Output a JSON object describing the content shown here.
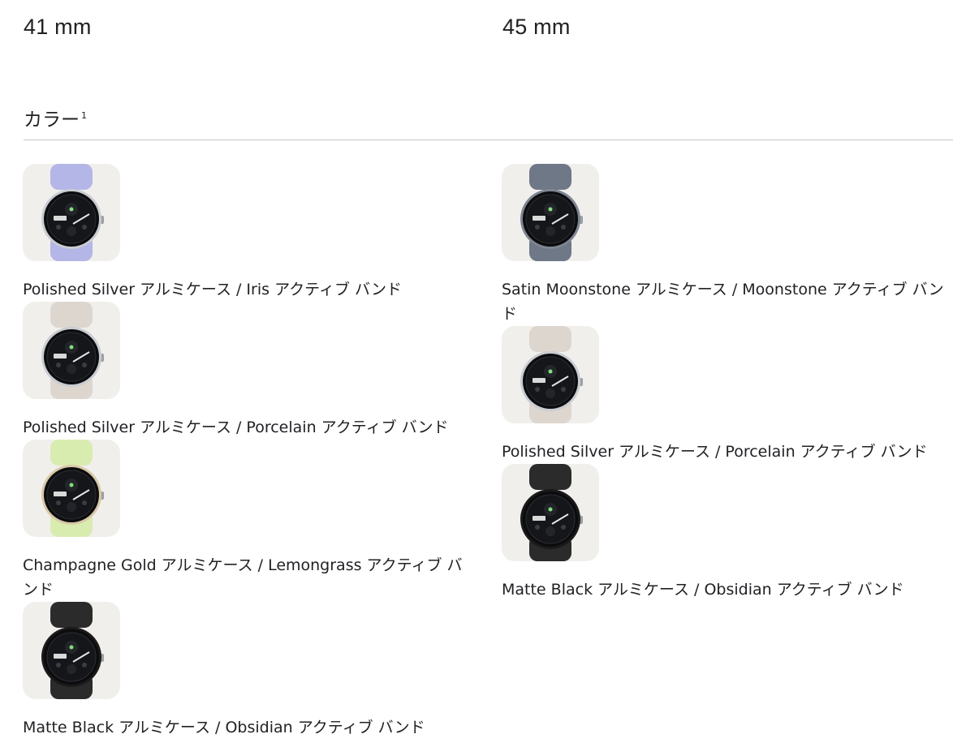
{
  "sizes": [
    {
      "label": "41 mm"
    },
    {
      "label": "45 mm"
    }
  ],
  "color_heading": "カラー",
  "color_heading_footnote": "1",
  "left_items": [
    {
      "label": "Polished Silver アルミケース / Iris アクティブ バンド",
      "band_color": "#b3b6e6",
      "case_color": "#c9ccd1"
    },
    {
      "label": "Polished Silver アルミケース / Porcelain アクティブ バンド",
      "band_color": "#ddd6cf",
      "case_color": "#c9ccd1"
    },
    {
      "label": "Champagne Gold アルミケース / Lemongrass アクティブ バンド",
      "band_color": "#d9ecb0",
      "case_color": "#d9c9a8"
    },
    {
      "label": "Matte Black アルミケース / Obsidian アクティブ バンド",
      "band_color": "#2b2b2b",
      "case_color": "#1a1a1a"
    }
  ],
  "right_items": [
    {
      "label": "Satin Moonstone アルミケース / Moonstone アクティブ バンド",
      "band_color": "#6f7886",
      "case_color": "#7d8592"
    },
    {
      "label": "Polished Silver アルミケース / Porcelain アクティブ バンド",
      "band_color": "#ddd6cf",
      "case_color": "#c9ccd1"
    },
    {
      "label": "Matte Black アルミケース / Obsidian アクティブ バンド",
      "band_color": "#2b2b2b",
      "case_color": "#1a1a1a"
    }
  ]
}
